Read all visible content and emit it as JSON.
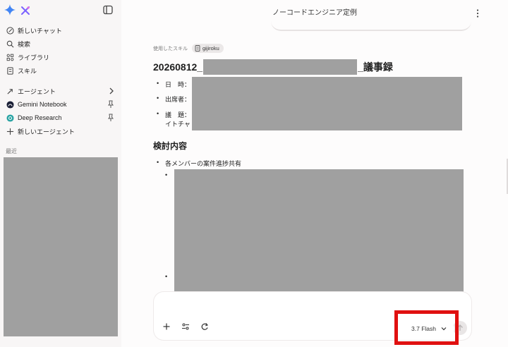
{
  "app": {
    "title": "ノーコードエンジニア定例"
  },
  "sidebar": {
    "items": [
      {
        "label": "新しいチャット",
        "icon": "new-chat-icon"
      },
      {
        "label": "検索",
        "icon": "search-icon"
      },
      {
        "label": "ライブラリ",
        "icon": "library-icon"
      },
      {
        "label": "スキル",
        "icon": "skill-icon"
      }
    ],
    "agents": [
      {
        "label": "エージェント",
        "icon": "agent-icon"
      },
      {
        "label": "Gemini Notebook",
        "icon": "notebook-icon"
      },
      {
        "label": "Deep Research",
        "icon": "deep-research-icon"
      },
      {
        "label": "新しいエージェント",
        "icon": "plus-icon"
      }
    ],
    "recent_label": "最近"
  },
  "message": {
    "skill_used_label": "使用したスキル",
    "skill_chip": "gijiroku",
    "title_prefix": "20260812_",
    "title_suffix": "_議事録",
    "bullets": [
      {
        "label": "日　時："
      },
      {
        "label": "出席者："
      },
      {
        "label": "議　題：",
        "second_line": "イトチャ"
      }
    ],
    "section_heading": "検討内容",
    "sub_bullet": "各メンバーの案件進捗共有"
  },
  "composer": {
    "model_label": "3.7 Flash"
  },
  "colors": {
    "accent_red": "#e01010",
    "redaction": "#a0a0a0",
    "gemini_blue": "#4285f4"
  }
}
